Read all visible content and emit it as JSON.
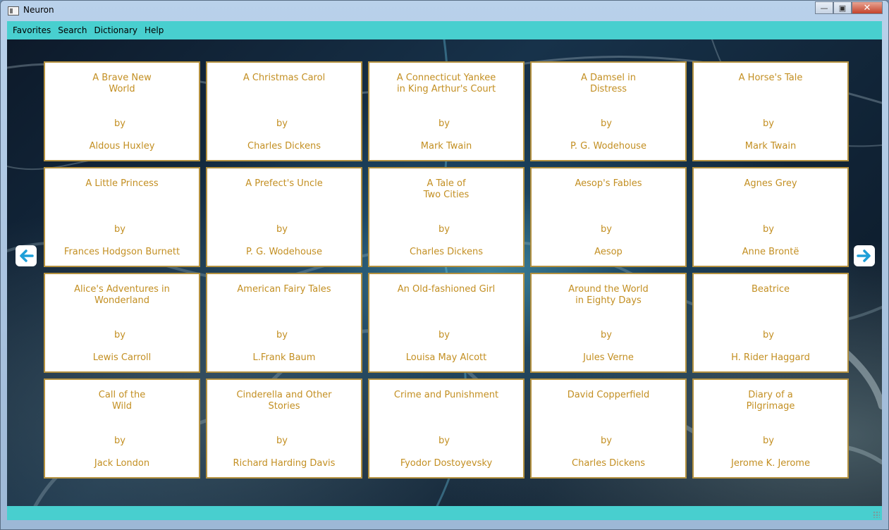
{
  "window": {
    "title": "Neuron"
  },
  "menu": [
    "Favorites",
    "Search",
    "Dictionary",
    "Help"
  ],
  "books": [
    {
      "title": "A Brave New World",
      "title_lines": [
        "A Brave New",
        "World"
      ],
      "by": "by",
      "author": "Aldous Huxley"
    },
    {
      "title": "A Christmas Carol",
      "title_lines": [
        "A Christmas Carol",
        ""
      ],
      "by": "by",
      "author": "Charles Dickens"
    },
    {
      "title": "A Connecticut Yankee in King Arthur's Court",
      "title_lines": [
        "A Connecticut Yankee",
        "in King Arthur's Court"
      ],
      "by": "by",
      "author": "Mark Twain"
    },
    {
      "title": "A Damsel in Distress",
      "title_lines": [
        "A Damsel in",
        "Distress"
      ],
      "by": "by",
      "author": "P. G. Wodehouse"
    },
    {
      "title": "A Horse's Tale",
      "title_lines": [
        "A Horse's Tale",
        ""
      ],
      "by": "by",
      "author": "Mark Twain"
    },
    {
      "title": "A Little Princess",
      "title_lines": [
        "A Little Princess",
        ""
      ],
      "by": "by",
      "author": "Frances Hodgson Burnett"
    },
    {
      "title": "A Prefect's Uncle",
      "title_lines": [
        "A Prefect's Uncle",
        ""
      ],
      "by": "by",
      "author": "P. G. Wodehouse"
    },
    {
      "title": "A Tale of Two Cities",
      "title_lines": [
        "A Tale of",
        "Two Cities"
      ],
      "by": "by",
      "author": "Charles Dickens"
    },
    {
      "title": "Aesop's Fables",
      "title_lines": [
        "Aesop's Fables",
        ""
      ],
      "by": "by",
      "author": "Aesop"
    },
    {
      "title": "Agnes Grey",
      "title_lines": [
        "Agnes Grey",
        ""
      ],
      "by": "by",
      "author": "Anne Brontë"
    },
    {
      "title": "Alice's Adventures in Wonderland",
      "title_lines": [
        "Alice's Adventures in",
        "Wonderland"
      ],
      "by": "by",
      "author": "Lewis Carroll"
    },
    {
      "title": "American Fairy Tales",
      "title_lines": [
        "American Fairy Tales",
        ""
      ],
      "by": "by",
      "author": "L.Frank Baum"
    },
    {
      "title": "An Old-fashioned Girl",
      "title_lines": [
        "An Old-fashioned Girl",
        ""
      ],
      "by": "by",
      "author": "Louisa May Alcott"
    },
    {
      "title": "Around the World in Eighty Days",
      "title_lines": [
        "Around the World",
        "in Eighty Days"
      ],
      "by": "by",
      "author": "Jules Verne"
    },
    {
      "title": "Beatrice",
      "title_lines": [
        "Beatrice",
        ""
      ],
      "by": "by",
      "author": "H. Rider Haggard"
    },
    {
      "title": "Call of the Wild",
      "title_lines": [
        "Call of the",
        "Wild"
      ],
      "by": "by",
      "author": "Jack London"
    },
    {
      "title": "Cinderella and Other Stories",
      "title_lines": [
        "Cinderella and Other",
        "Stories"
      ],
      "by": "by",
      "author": "Richard Harding Davis"
    },
    {
      "title": "Crime and Punishment",
      "title_lines": [
        "Crime and Punishment",
        ""
      ],
      "by": "by",
      "author": "Fyodor Dostoyevsky"
    },
    {
      "title": "David Copperfield",
      "title_lines": [
        "David Copperfield",
        ""
      ],
      "by": "by",
      "author": "Charles Dickens"
    },
    {
      "title": "Diary of a Pilgrimage",
      "title_lines": [
        "Diary of a",
        "Pilgrimage"
      ],
      "by": "by",
      "author": "Jerome K. Jerome"
    }
  ],
  "icons": {
    "prev": "arrow-left-icon",
    "next": "arrow-right-icon",
    "minimize": "minimize-icon",
    "maximize": "maximize-icon",
    "close": "close-icon"
  },
  "colors": {
    "accent": "#48cfcf",
    "card_text": "#c38f22",
    "card_border": "#b4913f",
    "arrow": "#1e9fd8"
  }
}
